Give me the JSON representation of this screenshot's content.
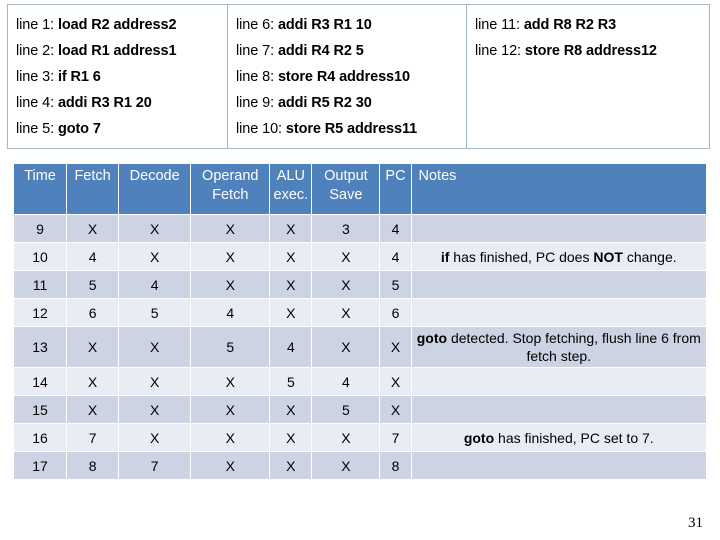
{
  "code_listing": {
    "columns": [
      {
        "lines": [
          {
            "label": "line 1:",
            "instruction": "load R2 address2"
          },
          {
            "label": "line 2:",
            "instruction": "load R1 address1"
          },
          {
            "label": "line 3:",
            "instruction": "if R1 6"
          },
          {
            "label": "line 4:",
            "instruction": "addi R3 R1 20"
          },
          {
            "label": "line 5:",
            "instruction": "goto 7"
          }
        ]
      },
      {
        "lines": [
          {
            "label": "line 6:",
            "instruction": "addi R3 R1 10"
          },
          {
            "label": "line 7:",
            "instruction": "addi R4 R2 5"
          },
          {
            "label": "line 8:",
            "instruction": "store R4 address10"
          },
          {
            "label": "line 9:",
            "instruction": "addi R5 R2 30"
          },
          {
            "label": "line 10:",
            "instruction": "store R5 address11"
          }
        ]
      },
      {
        "lines": [
          {
            "label": "line 11:",
            "instruction": "add R8 R2 R3"
          },
          {
            "label": "line 12:",
            "instruction": "store R8 address12"
          }
        ]
      }
    ]
  },
  "pipeline_table": {
    "headers": [
      "Time",
      "Fetch",
      "Decode",
      "Operand Fetch",
      "ALU exec.",
      "Output Save",
      "PC",
      "Notes"
    ],
    "rows": [
      {
        "time": "9",
        "fetch": "X",
        "decode": "X",
        "operand_fetch": "X",
        "alu": "X",
        "output_save": "3",
        "pc": "4",
        "note_html": "",
        "note_text": "",
        "shade": "dark",
        "tall": false
      },
      {
        "time": "10",
        "fetch": "4",
        "decode": "X",
        "operand_fetch": "X",
        "alu": "X",
        "output_save": "X",
        "pc": "4",
        "note_html": "<b>if</b> has finished, PC does <b>NOT</b> change.",
        "note_text": "if has finished, PC does NOT change.",
        "shade": "light",
        "tall": false
      },
      {
        "time": "11",
        "fetch": "5",
        "decode": "4",
        "operand_fetch": "X",
        "alu": "X",
        "output_save": "X",
        "pc": "5",
        "note_html": "",
        "note_text": "",
        "shade": "dark",
        "tall": false
      },
      {
        "time": "12",
        "fetch": "6",
        "decode": "5",
        "operand_fetch": "4",
        "alu": "X",
        "output_save": "X",
        "pc": "6",
        "note_html": "",
        "note_text": "",
        "shade": "light",
        "tall": false
      },
      {
        "time": "13",
        "fetch": "X",
        "decode": "X",
        "operand_fetch": "5",
        "alu": "4",
        "output_save": "X",
        "pc": "X",
        "note_html": "<b>goto</b> detected. Stop fetching, flush line 6 from fetch step.",
        "note_text": "goto detected. Stop fetching, flush line 6 from fetch step.",
        "shade": "dark",
        "tall": true
      },
      {
        "time": "14",
        "fetch": "X",
        "decode": "X",
        "operand_fetch": "X",
        "alu": "5",
        "output_save": "4",
        "pc": "X",
        "note_html": "",
        "note_text": "",
        "shade": "light",
        "tall": false
      },
      {
        "time": "15",
        "fetch": "X",
        "decode": "X",
        "operand_fetch": "X",
        "alu": "X",
        "output_save": "5",
        "pc": "X",
        "note_html": "",
        "note_text": "",
        "shade": "dark",
        "tall": false
      },
      {
        "time": "16",
        "fetch": "7",
        "decode": "X",
        "operand_fetch": "X",
        "alu": "X",
        "output_save": "X",
        "pc": "7",
        "note_html": "<b>goto</b> has finished, PC set to 7.",
        "note_text": "goto has finished, PC set to 7.",
        "shade": "light",
        "tall": false
      },
      {
        "time": "17",
        "fetch": "8",
        "decode": "7",
        "operand_fetch": "X",
        "alu": "X",
        "output_save": "X",
        "pc": "8",
        "note_html": "",
        "note_text": "",
        "shade": "dark",
        "tall": false
      }
    ]
  },
  "page_number": "31",
  "colors": {
    "header_blue": "#4f81bd",
    "row_dark": "#ccd4e4",
    "row_light": "#e8ecf4",
    "x_red": "#c0202a",
    "box_border": "#a6b6c6"
  }
}
